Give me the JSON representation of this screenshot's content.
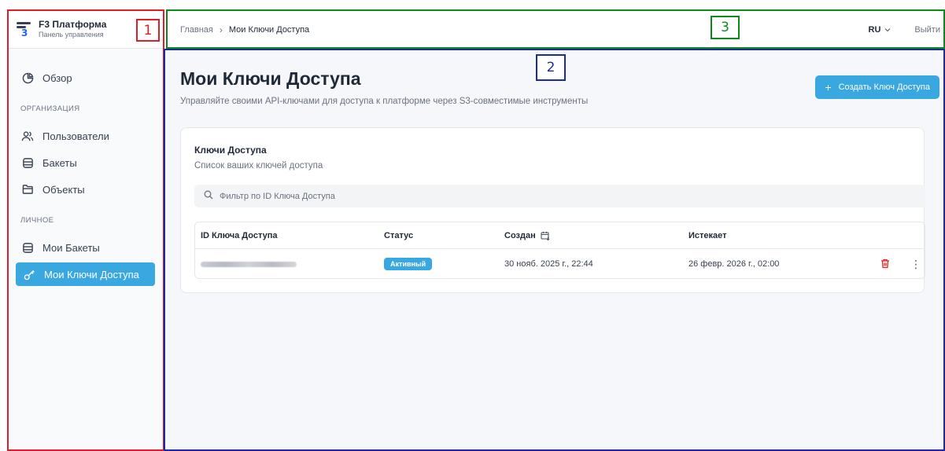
{
  "brand": {
    "logo_num": "3",
    "title": "F3 Платформа",
    "subtitle": "Панель управления"
  },
  "sidebar": {
    "overview": "Обзор",
    "section_org": "ОРГАНИЗАЦИЯ",
    "users": "Пользователи",
    "buckets": "Бакеты",
    "objects": "Объекты",
    "section_personal": "ЛИЧНОЕ",
    "my_buckets": "Мои Бакеты",
    "my_keys": "Мои Ключи Доступа"
  },
  "header": {
    "breadcrumb_home": "Главная",
    "breadcrumb_sep": "›",
    "breadcrumb_current": "Мои Ключи Доступа",
    "lang": "RU",
    "logout": "Выйти"
  },
  "main": {
    "title": "Мои Ключи Доступа",
    "subtitle": "Управляйте своими API-ключами для доступа к платформе через S3-совместимые инструменты",
    "create_button": "Создать Ключ Доступа",
    "card": {
      "title": "Ключи Доступа",
      "subtitle": "Список ваших ключей доступа",
      "filter_placeholder": "Фильтр по ID Ключа Доступа",
      "columns": [
        "ID Ключа Доступа",
        "Статус",
        "Создан",
        "Истекает"
      ],
      "rows": [
        {
          "status": "Активный",
          "created": "30 нояб. 2025 г., 22:44",
          "expires": "26 февр. 2026 г., 02:00"
        }
      ]
    }
  },
  "annotations": [
    "1",
    "2",
    "3"
  ],
  "colors": {
    "accent": "#3aa8e0",
    "annotation_1": "#e11d2a",
    "annotation_2": "#1e2a9c",
    "annotation_3": "#0b8a1c",
    "delete": "#dc2626"
  }
}
